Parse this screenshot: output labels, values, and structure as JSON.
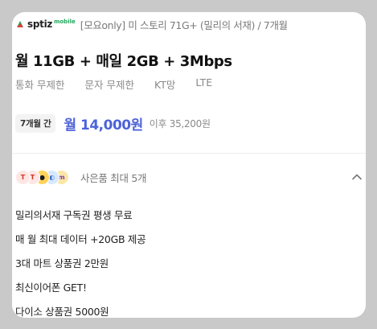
{
  "brand": {
    "name": "sptiz",
    "sub": "mobile"
  },
  "plan": {
    "name": "[모요only] 미 스토리 71G+ (밀리의 서재) / 7개월",
    "headline": "월 11GB + 매일 2GB + 3Mbps",
    "specs": [
      "통화 무제한",
      "문자 무제한",
      "KT망",
      "LTE"
    ]
  },
  "pricing": {
    "period_badge": "7개월 간",
    "promo_price": "월 14,000원",
    "after_price": "이후 35,200원"
  },
  "gifts": {
    "summary": "사은품 최대 5개",
    "icons": [
      {
        "icon": "t-brand-icon",
        "glyph": "T"
      },
      {
        "icon": "t-brand-icon",
        "glyph": "T"
      },
      {
        "icon": "yellow-character-icon",
        "glyph": "●"
      },
      {
        "icon": "earphone-icon",
        "glyph": "◐"
      },
      {
        "icon": "millie-icon",
        "glyph": "m"
      }
    ],
    "items": [
      "밀리의서재 구독권 평생 무료",
      "매 월 최대 데이터 +20GB 제공",
      "3대 마트 상품권 2만원",
      "최신이어폰 GET!",
      "다이소 상품권 5000원"
    ]
  },
  "colors": {
    "accent": "#4d63d9",
    "background": "#c9c9c9",
    "card": "#ffffff"
  }
}
